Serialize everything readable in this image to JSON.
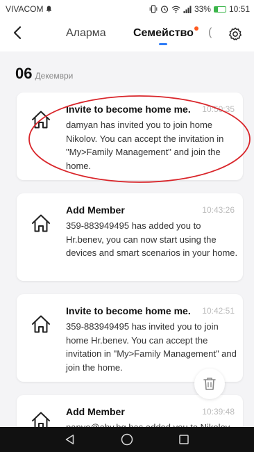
{
  "status_bar": {
    "carrier": "VIVACOM",
    "battery": "33%",
    "time": "10:51"
  },
  "header": {
    "tabs": [
      {
        "label": "Аларма",
        "active": false
      },
      {
        "label": "Семейство",
        "active": true
      }
    ],
    "icons": [
      "back-arrow-icon",
      "settings-gear-icon"
    ]
  },
  "date_group": {
    "day": "06",
    "month": "Декември"
  },
  "notifications": [
    {
      "title": "Invite to become home me...",
      "time": "10:50:35",
      "body": "damyan has invited you to join home Nikolov. You can accept the invitation in \"My>Family Management\" and join the home."
    },
    {
      "title": "Add Member",
      "time": "10:43:26",
      "body": "359-883949495 has added you to Hr.benev, you can now start using the devices and smart scenarios in your home."
    },
    {
      "title": "Invite to become home me...",
      "time": "10:42:51",
      "body": "359-883949495 has invited you to join home Hr.benev. You can accept the invitation in \"My>Family Management\" and join the home."
    },
    {
      "title": "Add Member",
      "time": "10:39:48",
      "body": "panyo@abv.bg has added you to Nikolov"
    }
  ],
  "colors": {
    "accent": "#2f7cf6",
    "badge": "#ff5a1f",
    "annotation": "#d9262b"
  }
}
